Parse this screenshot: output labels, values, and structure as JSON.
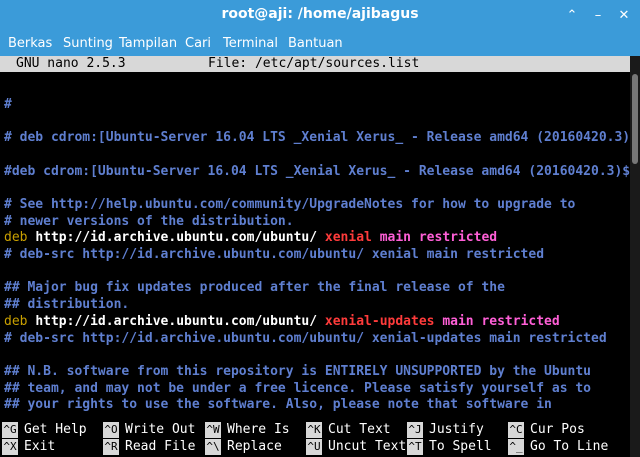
{
  "window": {
    "title": "root@aji: /home/ajibagus"
  },
  "window_controls": {
    "collapse": "⌃",
    "minimize": "–",
    "close": "✕"
  },
  "menu": [
    "Berkas",
    "Sunting",
    "Tampilan",
    "Cari",
    "Terminal",
    "Bantuan"
  ],
  "nano": {
    "version": "GNU nano 2.5.3",
    "file_label": "File: /etc/apt/sources.list"
  },
  "lines": [
    {
      "text": ""
    },
    {
      "text": "#"
    },
    {
      "text": ""
    },
    {
      "text": "# deb cdrom:[Ubuntu-Server 16.04 LTS _Xenial Xerus_ - Release amd64 (20160420.3)"
    },
    {
      "text": ""
    },
    {
      "text": "#deb cdrom:[Ubuntu-Server 16.04 LTS _Xenial Xerus_ - Release amd64 (20160420.3)$"
    },
    {
      "text": ""
    },
    {
      "text": "# See http://help.ubuntu.com/community/UpgradeNotes for how to upgrade to"
    },
    {
      "text": "# newer versions of the distribution."
    },
    {
      "segments": [
        {
          "t": "deb ",
          "c": "yellow"
        },
        {
          "t": "http://id.archive.ubuntu.com/ubuntu/ ",
          "c": "white"
        },
        {
          "t": "xenial ",
          "c": "red"
        },
        {
          "t": "main restricted",
          "c": "purple"
        }
      ]
    },
    {
      "text": "# deb-src http://id.archive.ubuntu.com/ubuntu/ xenial main restricted"
    },
    {
      "text": ""
    },
    {
      "text": "## Major bug fix updates produced after the final release of the"
    },
    {
      "text": "## distribution."
    },
    {
      "segments": [
        {
          "t": "deb ",
          "c": "yellow"
        },
        {
          "t": "http://id.archive.ubuntu.com/ubuntu/ ",
          "c": "white"
        },
        {
          "t": "xenial-updates ",
          "c": "red"
        },
        {
          "t": "main restricted",
          "c": "purple"
        }
      ]
    },
    {
      "text": "# deb-src http://id.archive.ubuntu.com/ubuntu/ xenial-updates main restricted"
    },
    {
      "text": ""
    },
    {
      "text": "## N.B. software from this repository is ENTIRELY UNSUPPORTED by the Ubuntu"
    },
    {
      "text": "## team, and may not be under a free licence. Please satisfy yourself as to"
    },
    {
      "text": "## your rights to use the software. Also, please note that software in"
    }
  ],
  "shortcuts": [
    {
      "key": "^G",
      "label": "Get Help"
    },
    {
      "key": "^O",
      "label": "Write Out"
    },
    {
      "key": "^W",
      "label": "Where Is"
    },
    {
      "key": "^K",
      "label": "Cut Text"
    },
    {
      "key": "^J",
      "label": "Justify"
    },
    {
      "key": "^C",
      "label": "Cur Pos"
    },
    {
      "key": "^X",
      "label": "Exit"
    },
    {
      "key": "^R",
      "label": "Read File"
    },
    {
      "key": "^\\",
      "label": "Replace"
    },
    {
      "key": "^U",
      "label": "Uncut Text"
    },
    {
      "key": "^T",
      "label": "To Spell"
    },
    {
      "key": "^_",
      "label": "Go To Line"
    }
  ]
}
